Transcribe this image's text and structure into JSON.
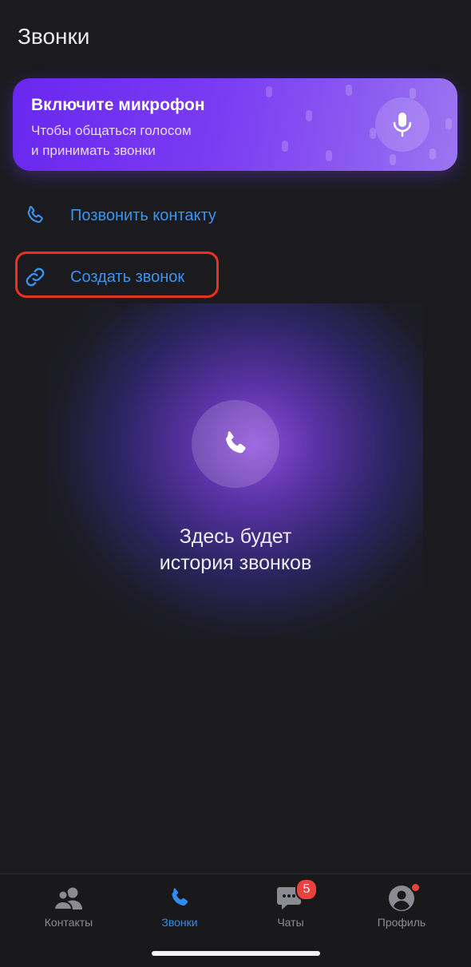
{
  "header": {
    "title": "Звонки"
  },
  "mic_banner": {
    "title": "Включите микрофон",
    "subtitle_line1": "Чтобы общаться голосом",
    "subtitle_line2": "и принимать звонки",
    "icon": "microphone-icon"
  },
  "actions": [
    {
      "label": "Позвонить контакту",
      "icon": "phone-icon"
    },
    {
      "label": "Создать звонок",
      "icon": "link-icon"
    }
  ],
  "empty_state": {
    "line1": "Здесь будет",
    "line2": "история звонков",
    "icon": "phone-icon"
  },
  "tabbar": {
    "tabs": [
      {
        "label": "Контакты",
        "icon": "contacts-icon",
        "active": false
      },
      {
        "label": "Звонки",
        "icon": "phone-icon",
        "active": true
      },
      {
        "label": "Чаты",
        "icon": "chat-icon",
        "active": false,
        "badge": "5"
      },
      {
        "label": "Профиль",
        "icon": "profile-icon",
        "active": false,
        "dot": true
      }
    ]
  },
  "colors": {
    "background": "#1b1b1f",
    "accent": "#3a93f0",
    "banner_start": "#6a27f0",
    "banner_end": "#9b76f0",
    "highlight": "#e8321f",
    "badge": "#e8423f"
  }
}
